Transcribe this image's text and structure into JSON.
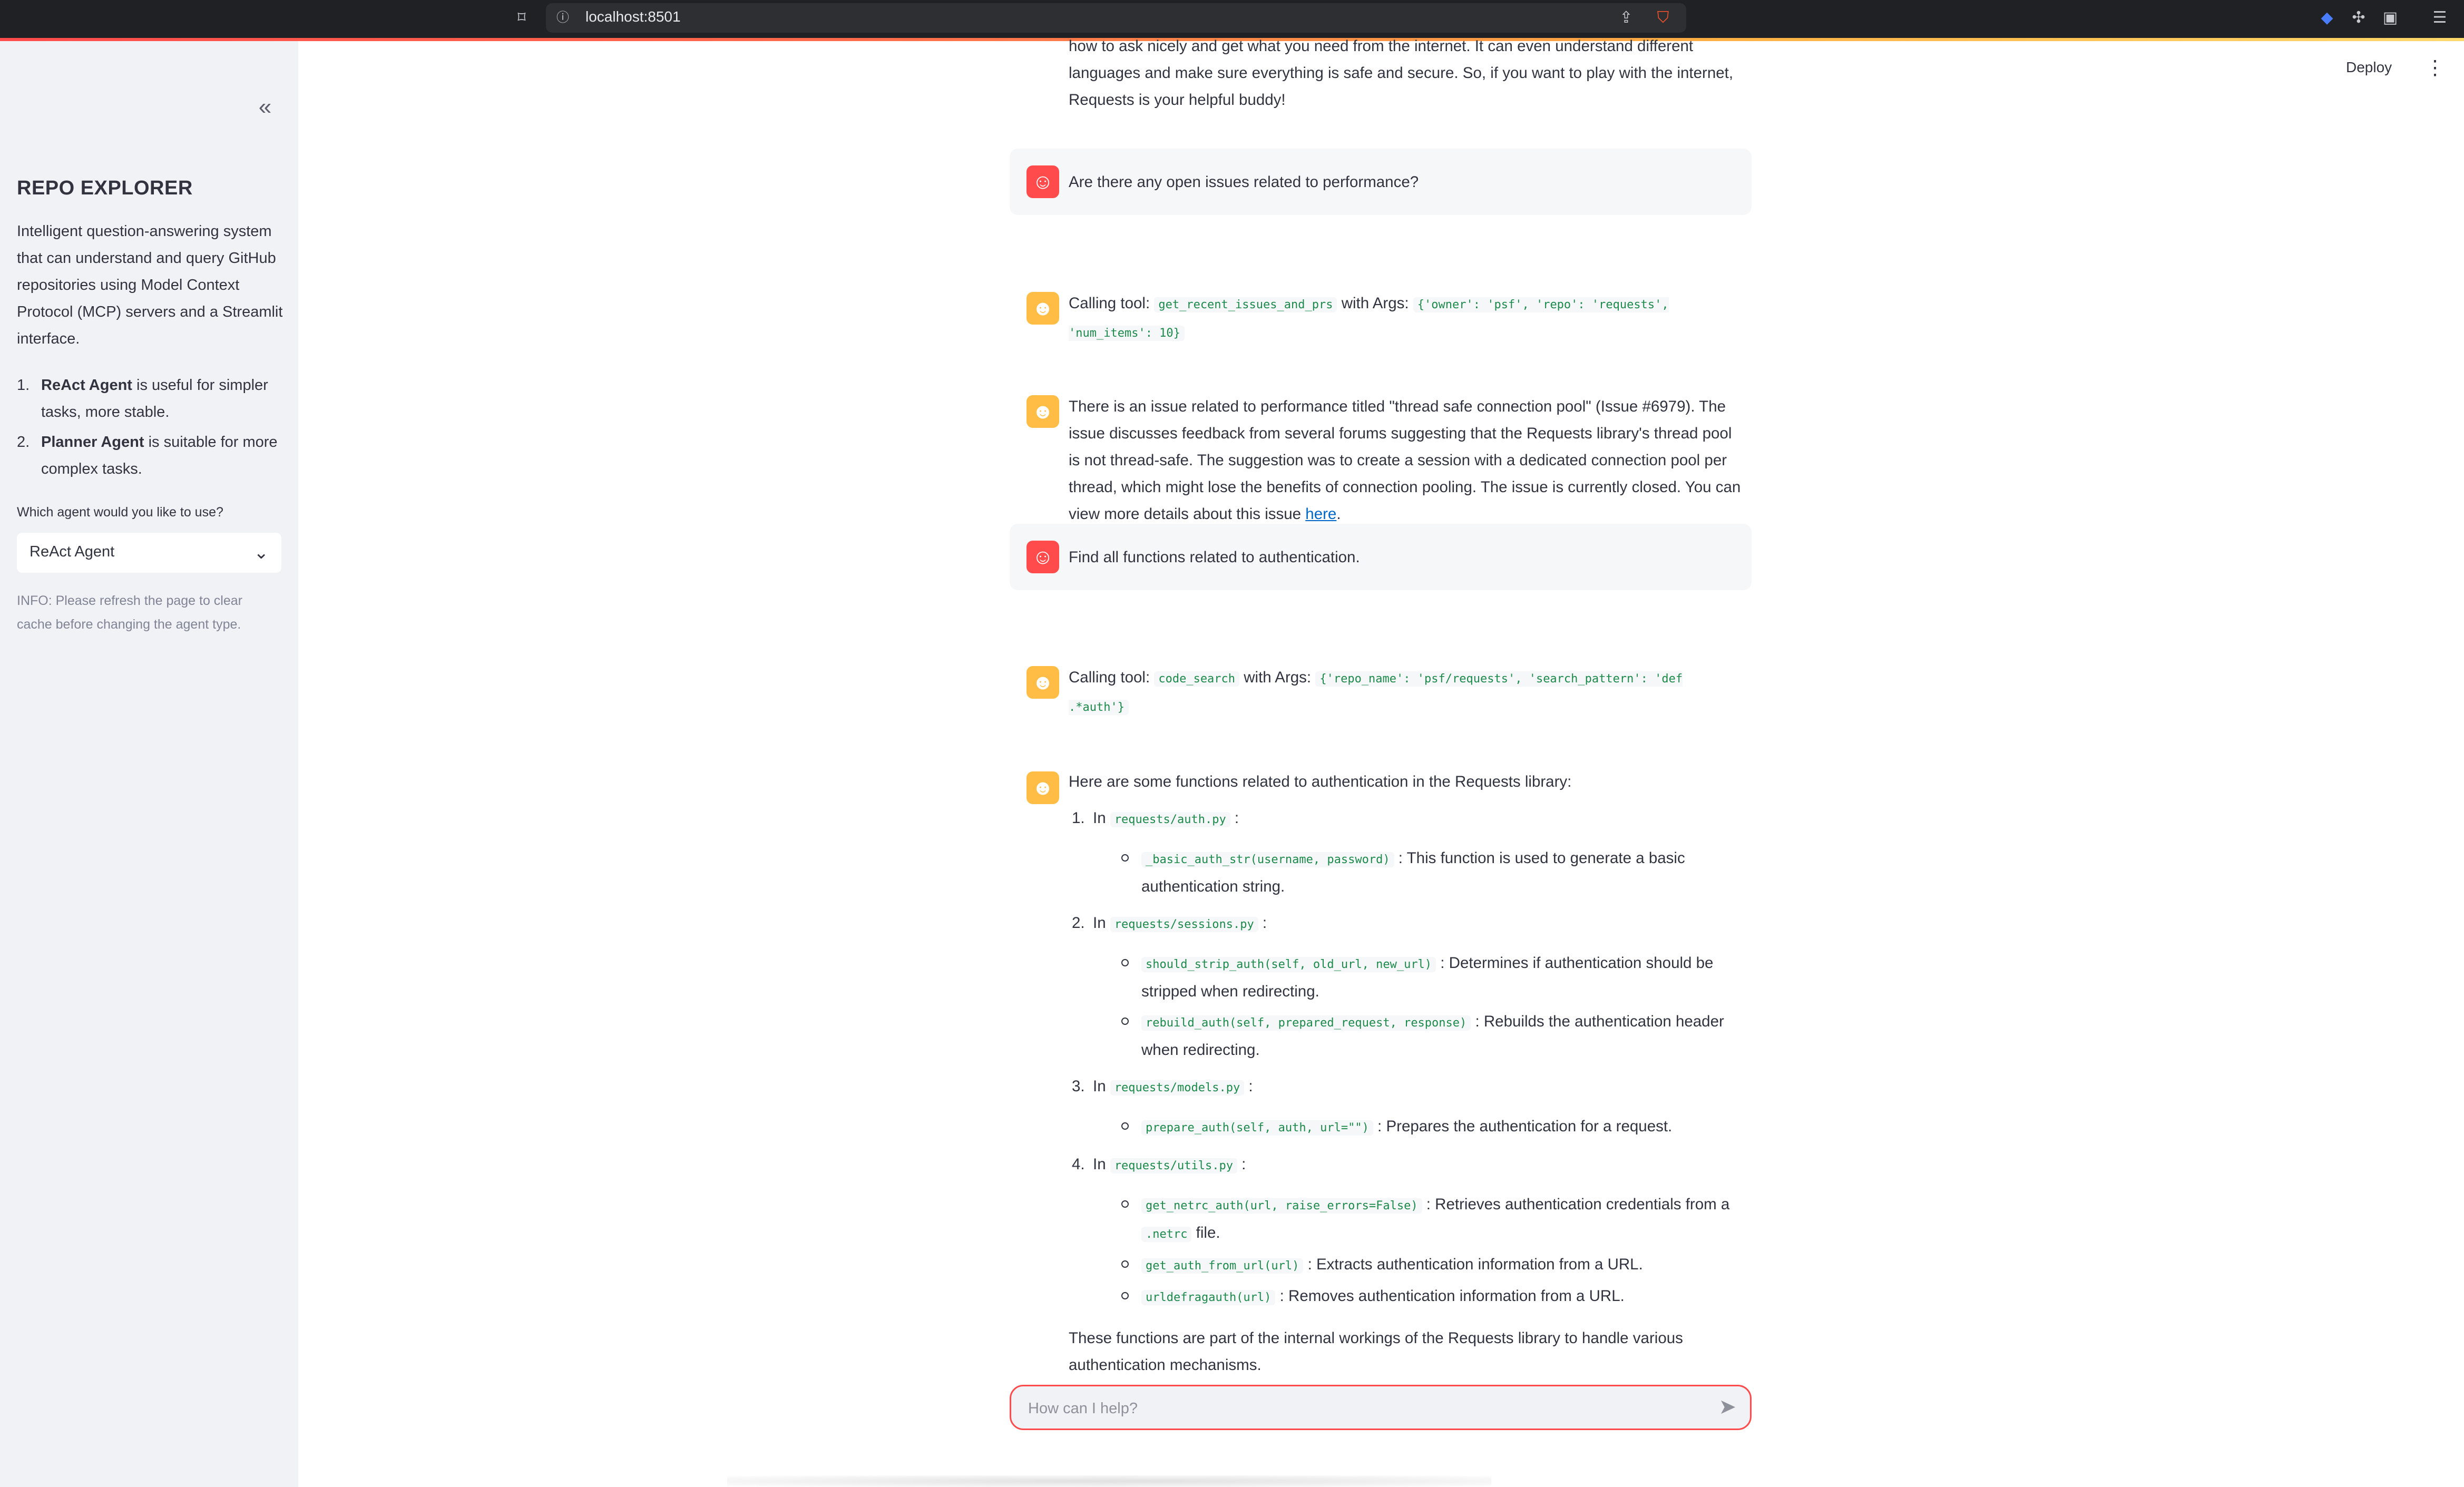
{
  "browser": {
    "url": "localhost:8501",
    "icons": [
      "bookmark-icon",
      "site-info-icon",
      "share-icon",
      "brave-shield-icon",
      "extension-icon",
      "puzzle-icon",
      "sidebar-icon",
      "hamburger-menu-icon"
    ]
  },
  "sidebar": {
    "collapse_icon": "«",
    "title": "REPO EXPLORER",
    "description": "Intelligent question-answering system that can understand and query GitHub repositories using Model Context Protocol (MCP) servers and a Streamlit interface.",
    "agents": [
      {
        "num": "1.",
        "name": "ReAct Agent",
        "desc": " is useful for simpler tasks, more stable."
      },
      {
        "num": "2.",
        "name": "Planner Agent",
        "desc": " is suitable for more complex tasks."
      }
    ],
    "select_label": "Which agent would you like to use?",
    "select_value": "ReAct Agent",
    "info": "INFO: Please refresh the page to clear cache before changing the agent type."
  },
  "header": {
    "deploy_label": "Deploy"
  },
  "chat": {
    "partial_top": "how to ask nicely and get what you need from the internet. It can even understand different languages and make sure everything is safe and secure. So, if you want to play with the internet, Requests is your helpful buddy!",
    "q1": "Are there any open issues related to performance?",
    "tool1": {
      "prefix": "Calling tool:",
      "name": "get_recent_issues_and_prs",
      "with": "with Args:",
      "args": "{'owner': 'psf', 'repo': 'requests', 'num_items': 10}"
    },
    "a1": {
      "text": "There is an issue related to performance titled \"thread safe connection pool\" (Issue #6979). The issue discusses feedback from several forums suggesting that the Requests library's thread pool is not thread-safe. The suggestion was to create a session with a dedicated connection pool per thread, which might lose the benefits of connection pooling. The issue is currently closed. You can view more details about this issue ",
      "link": "here",
      "end": "."
    },
    "q2": "Find all functions related to authentication.",
    "tool2": {
      "prefix": "Calling tool:",
      "name": "code_search",
      "with": "with Args:",
      "args": "{'repo_name': 'psf/requests', 'search_pattern': 'def .*auth'}"
    },
    "a2": {
      "intro": "Here are some functions related to authentication in the Requests library:",
      "files": [
        {
          "num": "1.",
          "in": "In",
          "file": "requests/auth.py",
          "functions": [
            {
              "sig": "_basic_auth_str(username, password)",
              "desc": ": This function is used to generate a basic authentication string."
            }
          ]
        },
        {
          "num": "2.",
          "in": "In",
          "file": "requests/sessions.py",
          "functions": [
            {
              "sig": "should_strip_auth(self, old_url, new_url)",
              "desc": ": Determines if authentication should be stripped when redirecting."
            },
            {
              "sig": "rebuild_auth(self, prepared_request, response)",
              "desc": ": Rebuilds the authentication header when redirecting."
            }
          ]
        },
        {
          "num": "3.",
          "in": "In",
          "file": "requests/models.py",
          "functions": [
            {
              "sig": "prepare_auth(self, auth, url=\"\")",
              "desc": ": Prepares the authentication for a request."
            }
          ]
        },
        {
          "num": "4.",
          "in": "In",
          "file": "requests/utils.py",
          "functions": [
            {
              "sig": "get_netrc_auth(url, raise_errors=False)",
              "desc": ": Retrieves authentication credentials from a ",
              "code2": ".netrc",
              "desc2": " file."
            },
            {
              "sig": "get_auth_from_url(url)",
              "desc": ": Extracts authentication information from a URL."
            },
            {
              "sig": "urldefragauth(url)",
              "desc": ": Removes authentication information from a URL."
            }
          ]
        }
      ],
      "outro": "These functions are part of the internal workings of the Requests library to handle various authentication mechanisms."
    }
  },
  "input": {
    "placeholder": "How can I help?",
    "send_icon": "send-icon"
  },
  "colors": {
    "accent": "#ff4b4b",
    "user_avatar": "#ff4b4b",
    "bot_avatar": "#ffbd45",
    "code": "#1b8a4a",
    "link": "#0068c9",
    "sidebar_bg": "#f0f2f6"
  }
}
